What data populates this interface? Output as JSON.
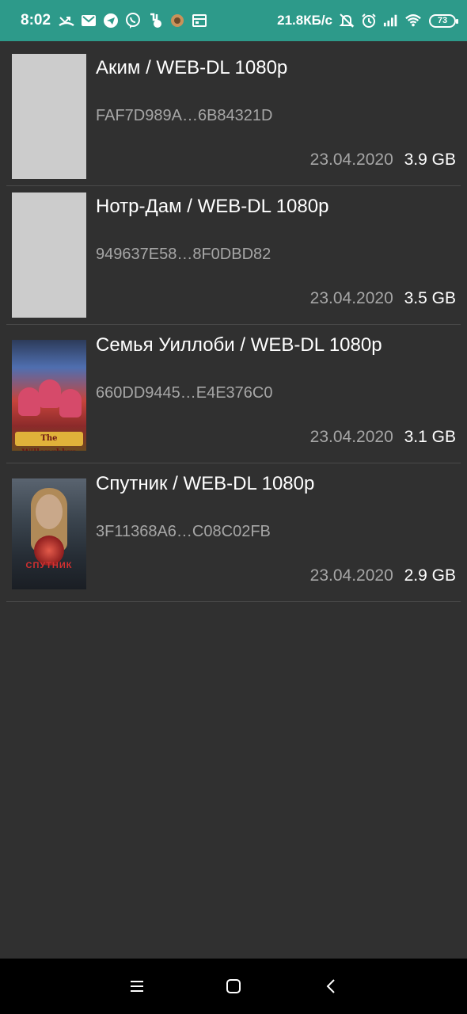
{
  "status_bar": {
    "time": "8:02",
    "net_speed": "21.8КБ/с",
    "battery": "73",
    "left_icons": [
      "missed-call-icon",
      "gmail-icon",
      "telegram-icon",
      "viber-icon",
      "call-forward-icon",
      "app-icon",
      "calendar-icon"
    ],
    "right_icons": [
      "mute-icon",
      "alarm-icon",
      "signal-icon",
      "wifi-icon"
    ]
  },
  "torrents": [
    {
      "title": "Аким / WEB-DL 1080p",
      "hash": "FAF7D989A…6B84321D",
      "date": "23.04.2020",
      "size": "3.9 GB",
      "poster": "placeholder"
    },
    {
      "title": "Нотр-Дам / WEB-DL 1080p",
      "hash": "949637E58…8F0DBD82",
      "date": "23.04.2020",
      "size": "3.5 GB",
      "poster": "placeholder"
    },
    {
      "title": "Семья Уиллоби / WEB-DL 1080p",
      "hash": "660DD9445…E4E376C0",
      "date": "23.04.2020",
      "size": "3.1 GB",
      "poster": "The Willoughbys"
    },
    {
      "title": "Спутник / WEB-DL 1080p",
      "hash": "3F11368A6…C08C02FB",
      "date": "23.04.2020",
      "size": "2.9 GB",
      "poster": "СПУТНИК"
    }
  ],
  "nav_bar": {
    "buttons": [
      "menu-icon",
      "home-icon",
      "back-icon"
    ]
  },
  "colors": {
    "status_bar": "#2d9a8a",
    "background": "#303030",
    "divider": "#4a4a4a",
    "secondary_text": "#a6a6a6"
  }
}
